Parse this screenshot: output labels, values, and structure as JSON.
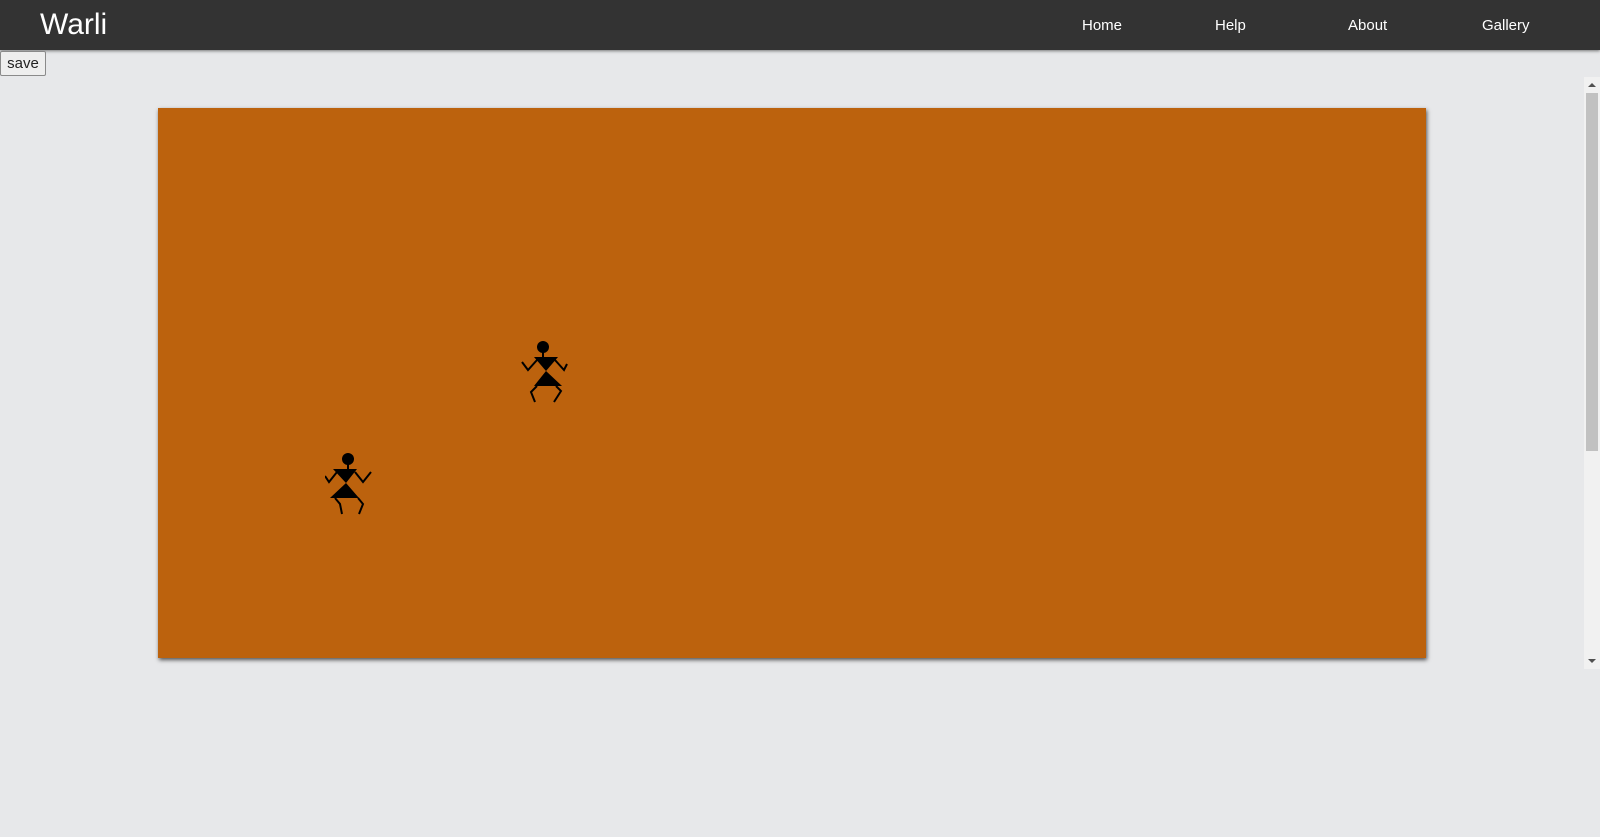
{
  "app": {
    "brand": "Warli"
  },
  "nav": {
    "items": [
      {
        "label": "Home"
      },
      {
        "label": "Help"
      },
      {
        "label": "About"
      },
      {
        "label": "Gallery"
      }
    ]
  },
  "toolbar": {
    "save_label": "save"
  },
  "canvas": {
    "background_color": "#bc620d",
    "figures": [
      {
        "icon": "warli-dancer-icon"
      },
      {
        "icon": "warli-dancer-icon"
      }
    ]
  },
  "colors": {
    "navbar": "#333333",
    "page_bg": "#e7e8ea"
  }
}
